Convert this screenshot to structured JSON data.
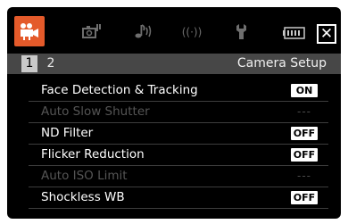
{
  "tabs": [
    {
      "icon": "movie-camera-icon",
      "active": true
    },
    {
      "icon": "camera-settings-icon",
      "active": false
    },
    {
      "icon": "audio-note-icon",
      "active": false
    },
    {
      "icon": "wireless-icon",
      "active": false
    },
    {
      "icon": "wrench-icon",
      "active": false
    }
  ],
  "battery_icon": "battery-icon",
  "close_label": "✕",
  "pages": [
    "1",
    "2"
  ],
  "current_page": "1",
  "section_title": "Camera Setup",
  "menu_items": [
    {
      "label": "Face Detection & Tracking",
      "value": "ON",
      "enabled": true
    },
    {
      "label": "Auto Slow Shutter",
      "value": "---",
      "enabled": false
    },
    {
      "label": "ND Filter",
      "value": "OFF",
      "enabled": true
    },
    {
      "label": "Flicker Reduction",
      "value": "OFF",
      "enabled": true
    },
    {
      "label": "Auto ISO Limit",
      "value": "---",
      "enabled": false
    },
    {
      "label": "Shockless WB",
      "value": "OFF",
      "enabled": true
    }
  ],
  "colors": {
    "accent": "#e45a2a",
    "background": "#000000",
    "subheader": "#474747",
    "disabled_text": "#555555"
  }
}
